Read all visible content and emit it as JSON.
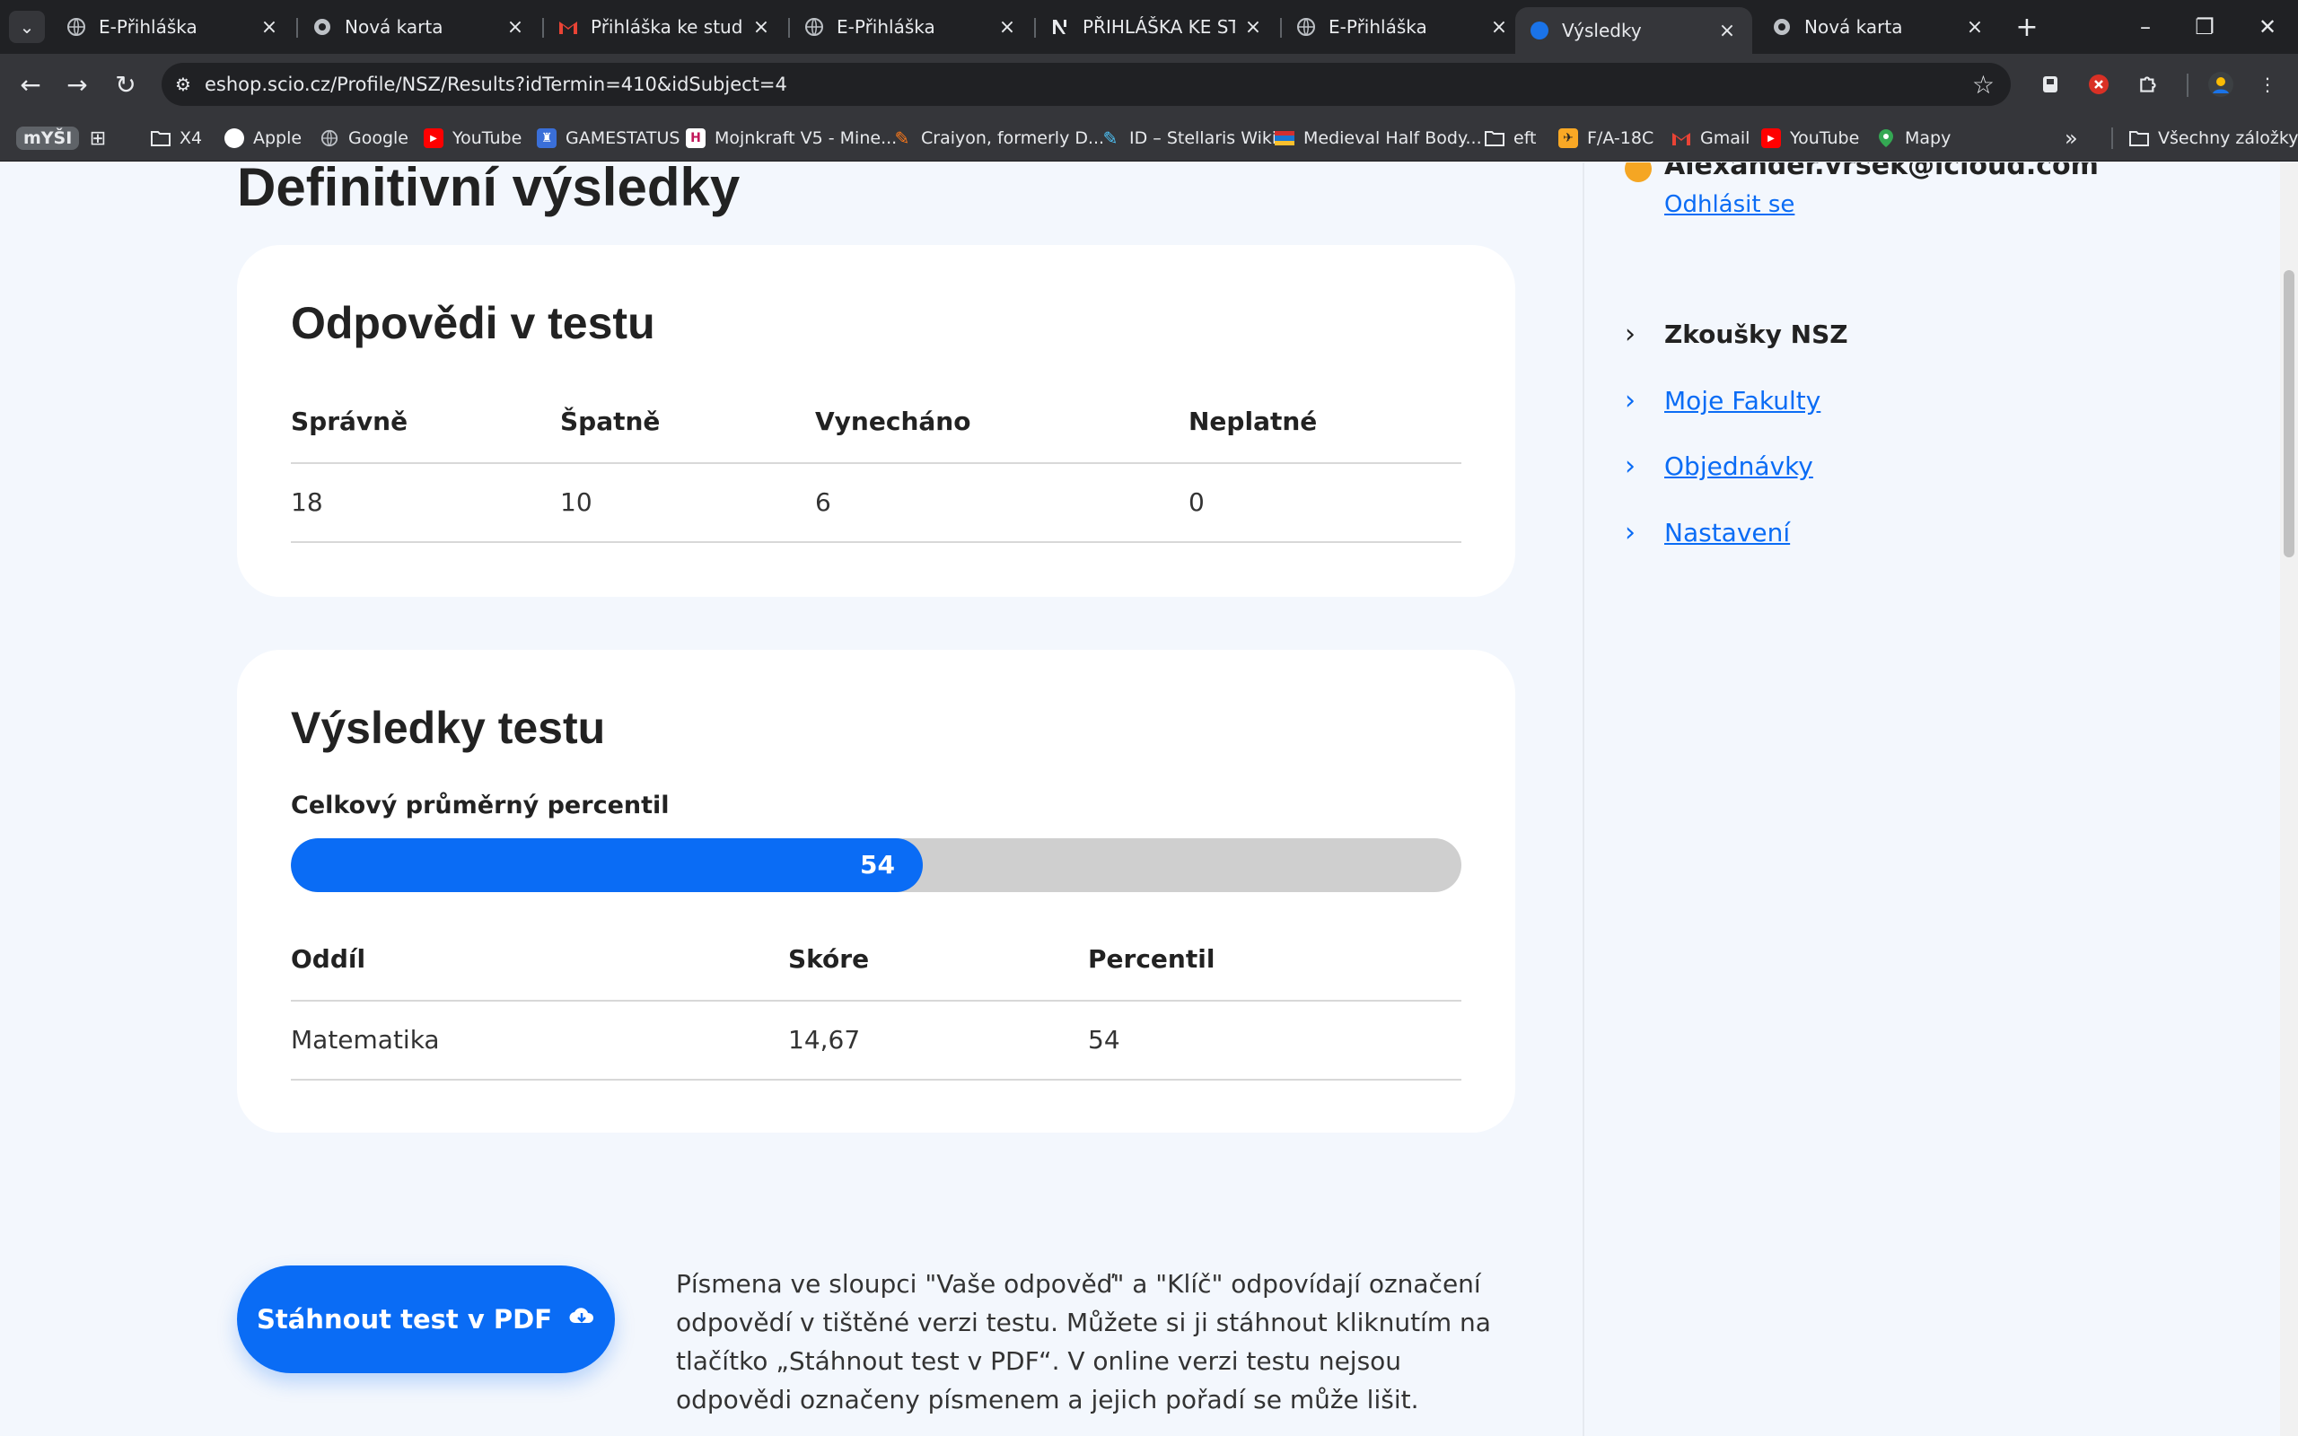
{
  "browser": {
    "tabs": [
      {
        "title": "E-Přihláška",
        "icon": "globe-icon"
      },
      {
        "title": "Nová karta",
        "icon": "chrome-icon"
      },
      {
        "title": "Přihláška ke studiu -",
        "icon": "gmail-icon"
      },
      {
        "title": "E-Přihláška",
        "icon": "globe-icon"
      },
      {
        "title": "PŘIHLÁŠKA KE STUD",
        "icon": "app-icon"
      },
      {
        "title": "E-Přihláška",
        "icon": "globe-icon"
      },
      {
        "title": "Výsledky",
        "icon": "loading-icon"
      },
      {
        "title": "Nová karta",
        "icon": "chrome-icon"
      }
    ],
    "active_tab_index": 6,
    "url": "eshop.scio.cz/Profile/NSZ/Results?idTermin=410&idSubject=4",
    "bookmarks": [
      {
        "label": "mYŠI"
      },
      {
        "label": ""
      },
      {
        "label": "X4",
        "icon": "folder-icon"
      },
      {
        "label": "Apple",
        "icon": "apple-icon"
      },
      {
        "label": "Google",
        "icon": "globe-icon"
      },
      {
        "label": "YouTube",
        "icon": "youtube-icon"
      },
      {
        "label": "GAMESTATUS",
        "icon": "gamestatus-icon"
      },
      {
        "label": "Mojnkraft V5 - Mine...",
        "icon": "site-icon"
      },
      {
        "label": "Craiyon, formerly D...",
        "icon": "pencil-icon"
      },
      {
        "label": "ID – Stellaris Wiki",
        "icon": "wiki-icon"
      },
      {
        "label": "Medieval Half Body...",
        "icon": "flag-icon"
      },
      {
        "label": "eft",
        "icon": "folder-icon"
      },
      {
        "label": "F/A-18C",
        "icon": "jet-icon"
      },
      {
        "label": "Gmail",
        "icon": "gmail-icon"
      },
      {
        "label": "YouTube",
        "icon": "youtube-icon"
      },
      {
        "label": "Mapy",
        "icon": "maps-icon"
      }
    ],
    "all_bookmarks_label": "Všechny záložky",
    "colors": {
      "chrome_dark": "#202124",
      "chrome_mid": "#35363a",
      "accent_blue": "#0a6cf5"
    }
  },
  "page": {
    "title": "Definitivní výsledky",
    "answers_card": {
      "heading": "Odpovědi v testu",
      "columns": [
        "Správně",
        "Špatně",
        "Vynecháno",
        "Neplatné"
      ],
      "values": [
        "18",
        "10",
        "6",
        "0"
      ]
    },
    "results_card": {
      "heading": "Výsledky testu",
      "percentile_label": "Celkový průměrný percentil",
      "percentile_value": "54",
      "percentile_fraction": 0.54,
      "columns": [
        "Oddíl",
        "Skóre",
        "Percentil"
      ],
      "rows": [
        [
          "Matematika",
          "14,67",
          "54"
        ]
      ]
    },
    "download_button": "Stáhnout test v PDF",
    "info_text": "Písmena ve sloupci \"Vaše odpověď\" a \"Klíč\" odpovídají označení odpovědí v tištěné verzi testu. Můžete si ji stáhnout kliknutím na tlačítko „Stáhnout test v PDF“. V online verzi testu nejsou odpovědi označeny písmenem a jejich pořadí se může lišit."
  },
  "sidebar": {
    "email": "Alexander.vrsek@icloud.com",
    "logout": "Odhlásit se",
    "items": [
      {
        "label": "Zkoušky NSZ",
        "current": true
      },
      {
        "label": "Moje Fakulty",
        "current": false
      },
      {
        "label": "Objednávky",
        "current": false
      },
      {
        "label": "Nastavení",
        "current": false
      }
    ]
  }
}
